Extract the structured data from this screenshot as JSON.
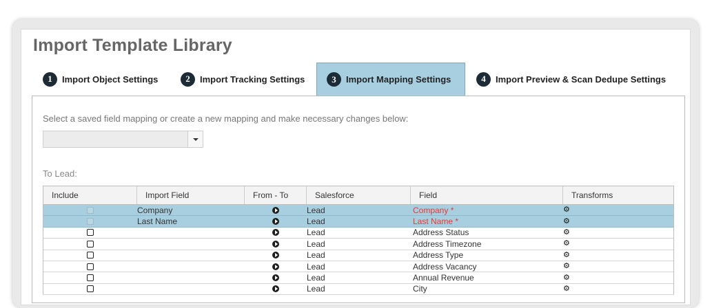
{
  "page": {
    "title": "Import Template Library"
  },
  "tabs": [
    {
      "num": "1",
      "label": "Import Object Settings"
    },
    {
      "num": "2",
      "label": "Import Tracking Settings"
    },
    {
      "num": "3",
      "label": "Import Mapping Settings"
    },
    {
      "num": "4",
      "label": "Import Preview & Scan Dedupe Settings"
    }
  ],
  "mapping": {
    "instruction": "Select a saved field mapping or create a new mapping and make necessary changes below:",
    "selected_value": "",
    "to_label": "To Lead:"
  },
  "grid": {
    "headers": [
      "Include",
      "Import Field",
      "From - To",
      "Salesforce",
      "Field",
      "Transforms"
    ],
    "rows": [
      {
        "import_field": "Company",
        "salesforce": "Lead",
        "field": "Company *",
        "required": true
      },
      {
        "import_field": "Last Name",
        "salesforce": "Lead",
        "field": "Last Name *",
        "required": true
      },
      {
        "import_field": "",
        "salesforce": "Lead",
        "field": "Address Status",
        "required": false
      },
      {
        "import_field": "",
        "salesforce": "Lead",
        "field": "Address Timezone",
        "required": false
      },
      {
        "import_field": "",
        "salesforce": "Lead",
        "field": "Address Type",
        "required": false
      },
      {
        "import_field": "",
        "salesforce": "Lead",
        "field": "Address Vacancy",
        "required": false
      },
      {
        "import_field": "",
        "salesforce": "Lead",
        "field": "Annual Revenue",
        "required": false
      },
      {
        "import_field": "",
        "salesforce": "Lead",
        "field": "City",
        "required": false
      }
    ]
  },
  "colors": {
    "accent": "#a8cfe0",
    "required": "#e03b3b",
    "badge": "#1d2b36"
  }
}
